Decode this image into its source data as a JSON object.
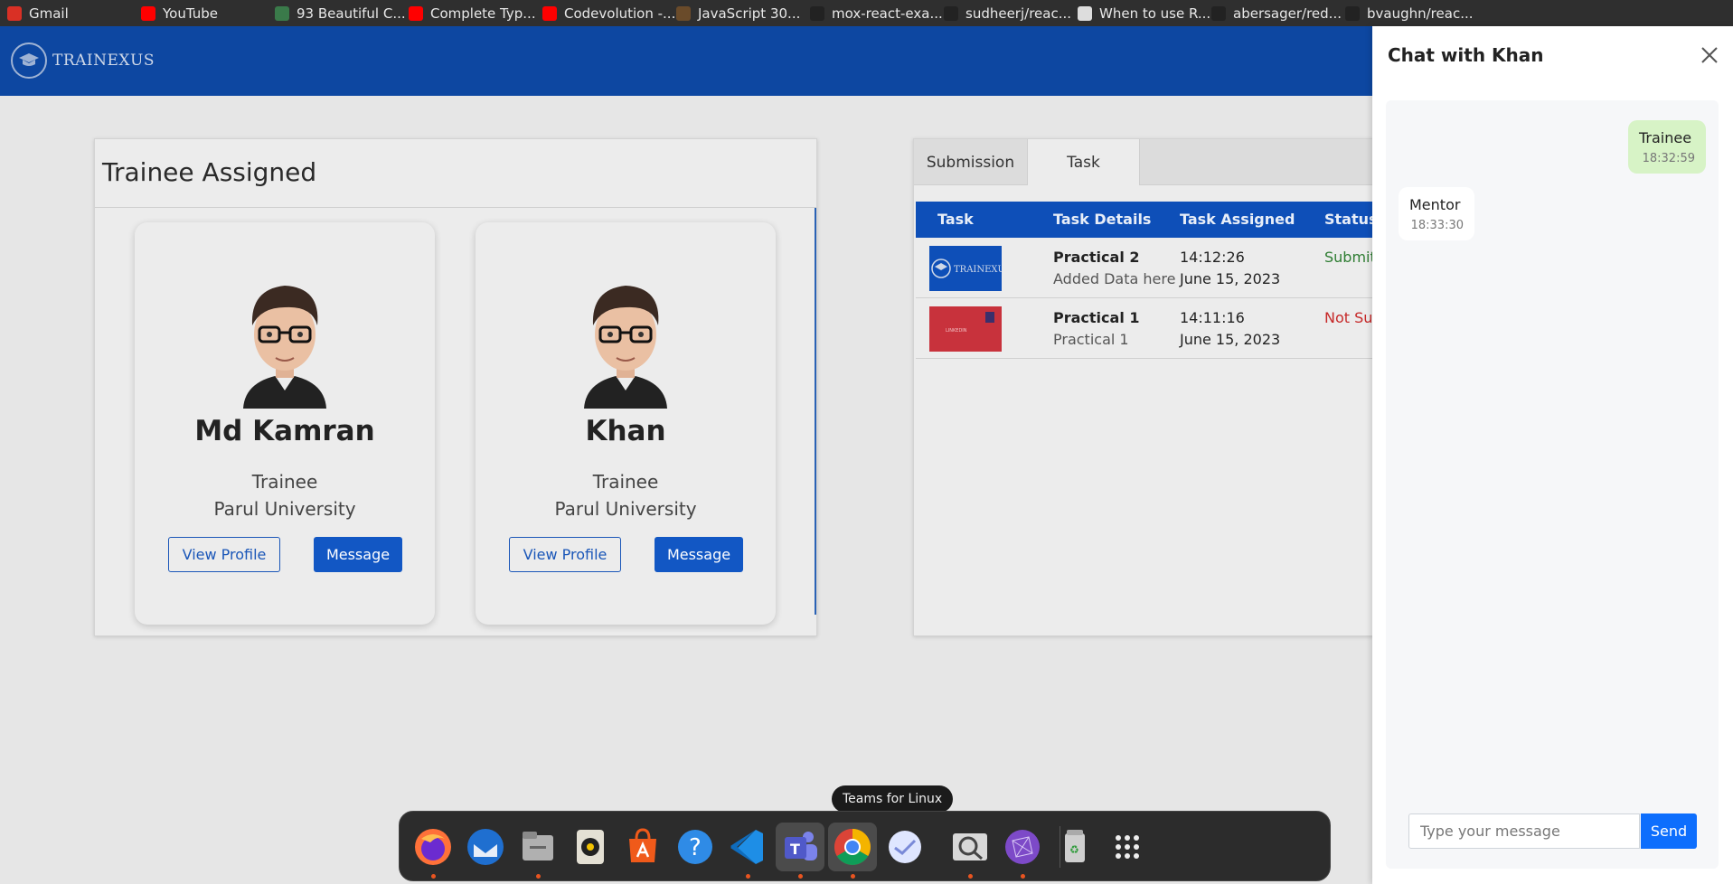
{
  "bookmarks": [
    {
      "label": "Gmail",
      "icon": "gmail-icon",
      "color": "#d93025"
    },
    {
      "label": "YouTube",
      "icon": "youtube-icon",
      "color": "#ff0000"
    },
    {
      "label": "93 Beautiful C...",
      "icon": "site-icon",
      "color": "#3a7a4a"
    },
    {
      "label": "Complete Typ...",
      "icon": "youtube-icon",
      "color": "#ff0000"
    },
    {
      "label": "Codevolution -...",
      "icon": "youtube-icon",
      "color": "#ff0000"
    },
    {
      "label": "JavaScript 30...",
      "icon": "js30-icon",
      "color": "#6a4b2a"
    },
    {
      "label": "mox-react-exa...",
      "icon": "github-icon",
      "color": "#222222"
    },
    {
      "label": "sudheerj/reac...",
      "icon": "github-icon",
      "color": "#222222"
    },
    {
      "label": "When to use R...",
      "icon": "globe-icon",
      "color": "#dddddd"
    },
    {
      "label": "abersager/red...",
      "icon": "github-icon",
      "color": "#222222"
    },
    {
      "label": "bvaughn/reac...",
      "icon": "github-icon",
      "color": "#222222"
    }
  ],
  "header": {
    "logo_text": "TRAINEXUS",
    "bg_color": "#0d47a1"
  },
  "assigned": {
    "title": "Trainee Assigned",
    "cards": [
      {
        "name": "Md Kamran",
        "role": "Trainee",
        "university": "Parul University",
        "view_label": "View Profile",
        "message_label": "Message"
      },
      {
        "name": "Khan",
        "role": "Trainee",
        "university": "Parul University",
        "view_label": "View Profile",
        "message_label": "Message"
      }
    ]
  },
  "tasks": {
    "tabs": [
      "Submission",
      "Task"
    ],
    "active_tab": "Task",
    "columns": [
      "Task",
      "Task Details",
      "Task Assigned",
      "Status"
    ],
    "rows": [
      {
        "title": "Practical 2",
        "detail": "Added Data here",
        "time": "14:12:26",
        "date": "June 15, 2023",
        "status": "Submitt",
        "status_color": "#2e7d32",
        "thumb": "trainexus-thumb",
        "thumb_text": "TRAINEXUS"
      },
      {
        "title": "Practical 1",
        "detail": "Practical 1",
        "time": "14:11:16",
        "date": "June 15, 2023",
        "status": "Not Sub",
        "status_color": "#c62828",
        "thumb": "red-banner-thumb",
        "thumb_text": "LINKEDIN"
      }
    ]
  },
  "chat": {
    "title": "Chat with Khan",
    "messages": [
      {
        "sender": "Trainee",
        "time": "18:32:59",
        "side": "right"
      },
      {
        "sender": "Mentor",
        "time": "18:33:30",
        "side": "left"
      }
    ],
    "input_placeholder": "Type your message",
    "send_label": "Send"
  },
  "dock": {
    "tooltip": "Teams for Linux",
    "apps": [
      "firefox-icon",
      "thunderbird-icon",
      "files-icon",
      "rhythmbox-icon",
      "app-center-icon",
      "help-icon",
      "vscode-icon",
      "teams-icon",
      "chrome-icon",
      "mail-icon",
      "image-viewer-icon",
      "tor-icon",
      "trash-icon",
      "app-grid-icon"
    ]
  }
}
